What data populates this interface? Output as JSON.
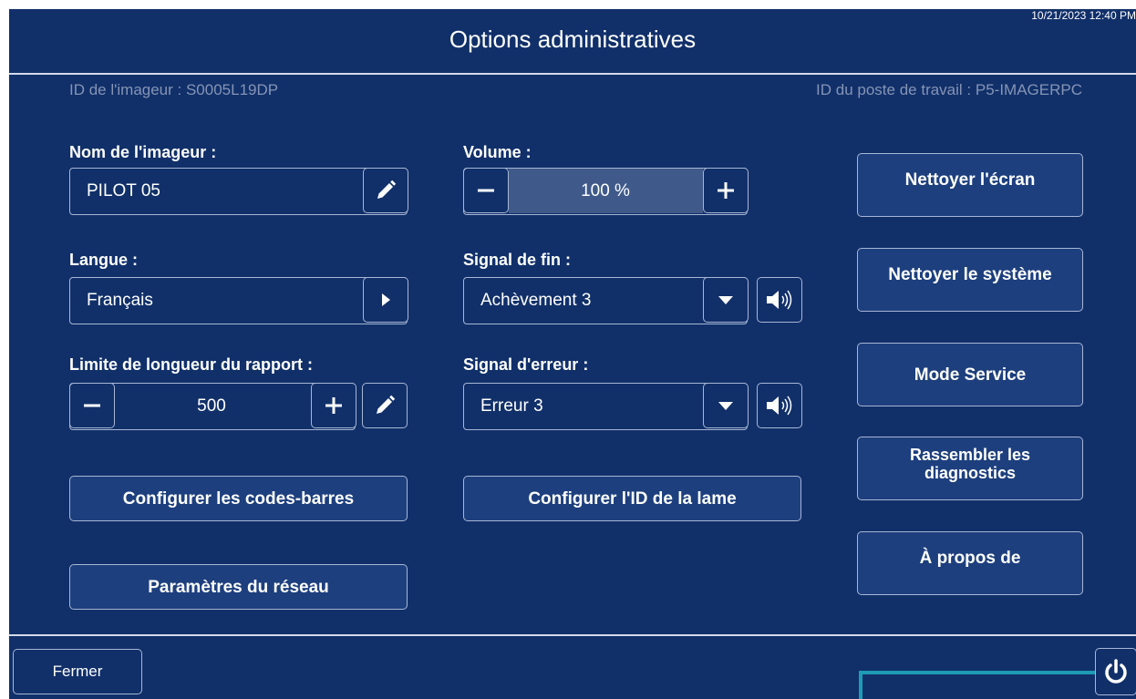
{
  "header": {
    "title": "Options administratives",
    "datetime": "10/21/2023 12:40 PM",
    "imager_id": "ID de l'imageur : S0005L19DP",
    "workstation_id": "ID du poste de travail : P5-IMAGERPC"
  },
  "imager_name": {
    "label": "Nom de l'imageur :",
    "value": "PILOT 05"
  },
  "language": {
    "label": "Langue :",
    "value": "Français"
  },
  "report_limit": {
    "label": "Limite de longueur du rapport :",
    "value": "500"
  },
  "volume": {
    "label": "Volume :",
    "value": "100 %",
    "level_percent": 100
  },
  "end_signal": {
    "label": "Signal de fin :",
    "value": "Achèvement 3"
  },
  "error_signal": {
    "label": "Signal d'erreur :",
    "value": "Erreur 3"
  },
  "buttons": {
    "configure_barcodes": "Configurer les codes-barres",
    "network_settings": "Paramètres du réseau",
    "configure_slide_id": "Configurer l'ID de la lame",
    "clean_screen": "Nettoyer l'écran",
    "clean_system": "Nettoyer le système",
    "service_mode": "Mode Service",
    "gather_diagnostics": "Rassembler les diagnostics",
    "about": "À propos de",
    "close": "Fermer"
  },
  "icons": {
    "edit": "pencil-icon",
    "arrow": "play-right-icon",
    "dropdown": "caret-down-icon",
    "sound": "speaker-icon",
    "minus": "minus-icon",
    "plus": "plus-icon",
    "power": "power-icon"
  },
  "colors": {
    "background": "#11306a",
    "button_fill": "#1d3f7e",
    "border": "#a7b6d4",
    "muted_text": "#8594b4",
    "volume_fill": "#3f5a8a",
    "accent": "#1e9bb5"
  }
}
